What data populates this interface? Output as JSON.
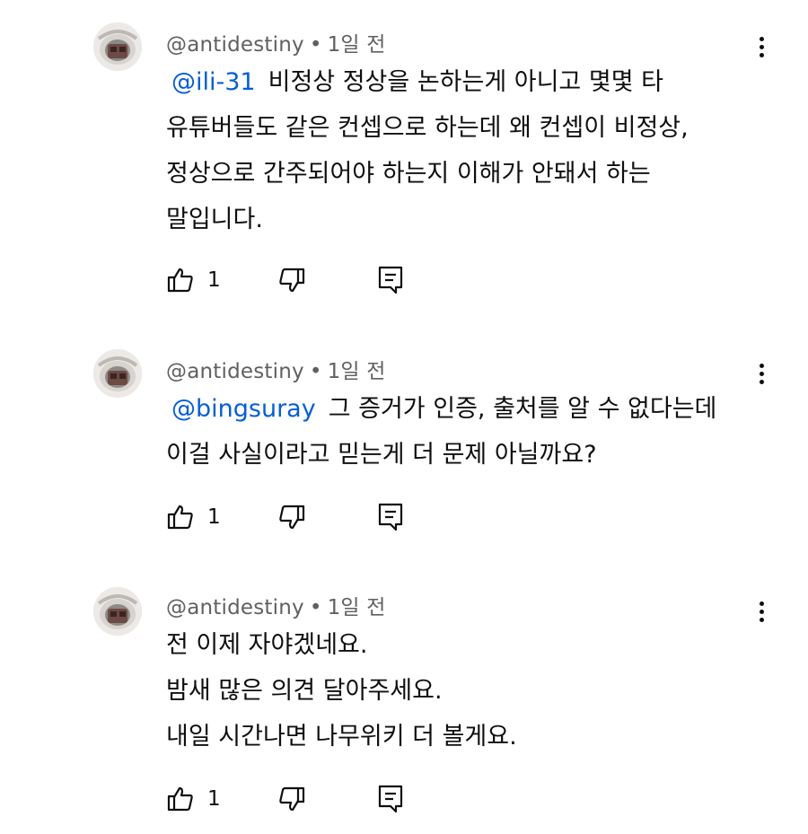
{
  "comments": [
    {
      "author": "@antidestiny",
      "separator": "•",
      "time": "1일 전",
      "mention": "@ili-31",
      "lines": [
        "비정상 정상을 논하는게 아니고 몇몇 타",
        "유튜버들도 같은 컨셉으로 하는데 왜 컨셉이 비정상,",
        "정상으로 간주되어야 하는지 이해가 안돼서 하는",
        "말입니다."
      ],
      "likes": "1",
      "icons": {
        "like": "thumbs-up-icon",
        "dislike": "thumbs-down-icon",
        "reply": "reply-comment-icon",
        "menu": "more-vert-icon"
      }
    },
    {
      "author": "@antidestiny",
      "separator": "•",
      "time": "1일 전",
      "mention": "@bingsuray",
      "lines": [
        "그 증거가 인증, 출처를 알 수 없다는데",
        "이걸 사실이라고 믿는게 더 문제 아닐까요?"
      ],
      "likes": "1",
      "icons": {
        "like": "thumbs-up-icon",
        "dislike": "thumbs-down-icon",
        "reply": "reply-comment-icon",
        "menu": "more-vert-icon"
      }
    },
    {
      "author": "@antidestiny",
      "separator": "•",
      "time": "1일 전",
      "mention": "",
      "lines": [
        "전 이제 자야겠네요.",
        "밤새 많은 의견 달아주세요.",
        "내일 시간나면 나무위키 더 볼게요."
      ],
      "likes": "1",
      "icons": {
        "like": "thumbs-up-icon",
        "dislike": "thumbs-down-icon",
        "reply": "reply-comment-icon",
        "menu": "more-vert-icon"
      }
    }
  ],
  "colors": {
    "text": "#0f0f0f",
    "meta": "#606060",
    "mention": "#065fd4",
    "background": "#ffffff"
  }
}
